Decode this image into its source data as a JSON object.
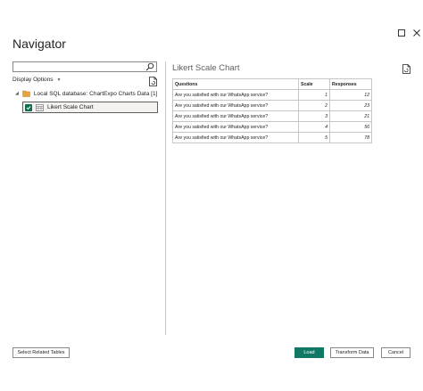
{
  "window": {
    "title": "Navigator"
  },
  "left_panel": {
    "search_placeholder": "",
    "display_options_label": "Display Options",
    "tree": {
      "database_label": "Local SQL database: ChartExpo Charts Data [1]",
      "items": [
        {
          "label": "Likert Scale Chart",
          "checked": true
        }
      ]
    }
  },
  "preview": {
    "title": "Likert Scale Chart",
    "columns": [
      "Questions",
      "Scale",
      "Responses"
    ],
    "rows": [
      [
        "Are you satisfied with our WhatsApp service?",
        "1",
        "12"
      ],
      [
        "Are you satisfied with our WhatsApp service?",
        "2",
        "23"
      ],
      [
        "Are you satisfied with our WhatsApp service?",
        "3",
        "21"
      ],
      [
        "Are you satisfied with our WhatsApp service?",
        "4",
        "56"
      ],
      [
        "Are you satisfied with our WhatsApp service?",
        "5",
        "78"
      ]
    ]
  },
  "footer": {
    "select_related_label": "Select Related Tables",
    "load_label": "Load",
    "transform_label": "Transform Data",
    "cancel_label": "Cancel"
  },
  "colors": {
    "accent": "#117865",
    "checkbox": "#0f6e4f",
    "folder": "#e8a33d"
  }
}
